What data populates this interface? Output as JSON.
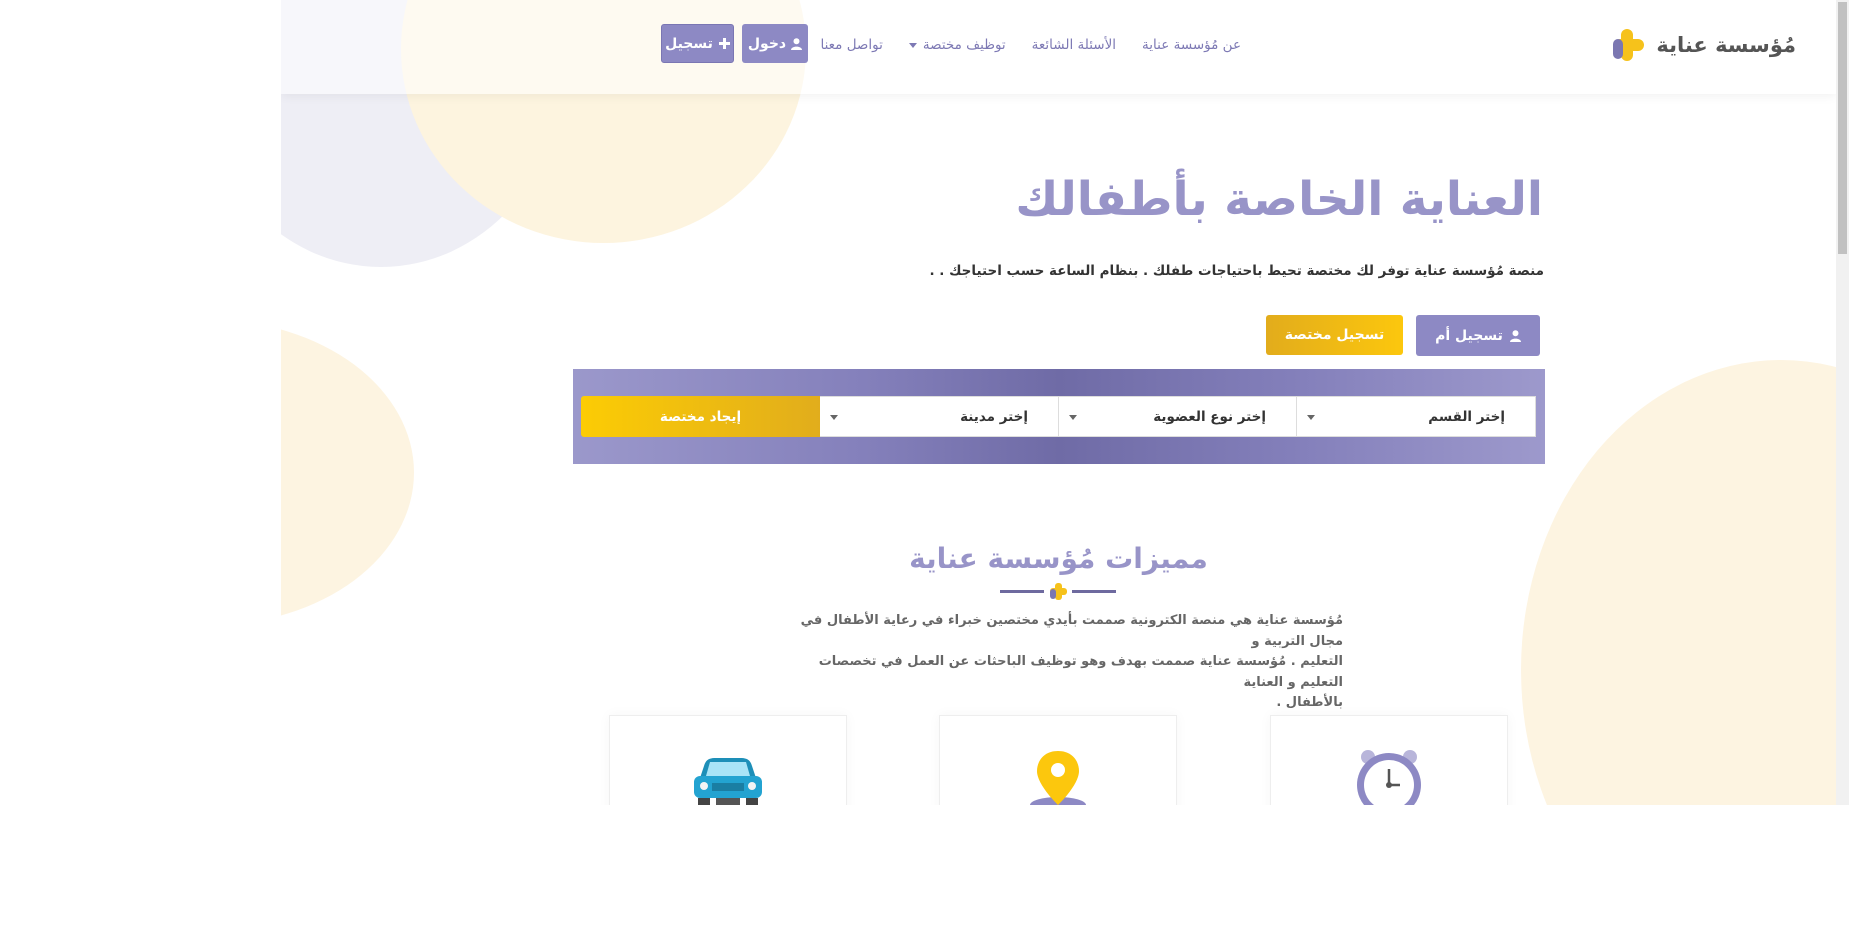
{
  "header": {
    "logo_text": "مُؤسسة عناية",
    "nav": {
      "about": "عن مُؤسسة عناية",
      "faq": "الأسئلة الشائعة",
      "hire": "توظيف مختصة",
      "contact": "تواصل معنا"
    },
    "login_label": "دخول",
    "register_label": "تسجيل"
  },
  "hero": {
    "title": "العناية الخاصة بأطفالك",
    "subtitle": "منصة مُؤسسة عناية توفر لك مختصة تحيط باحتياجات طفلك . بنظام الساعة حسب احتياجك . .",
    "register_mother": "تسجيل أم",
    "register_specialist": "تسجيل مختصة"
  },
  "search": {
    "category": "إختر القسم",
    "membership": "إختر نوع العضوية",
    "city": "إختر مدينة",
    "find_button": "إيجاد مختصة"
  },
  "features": {
    "title": "مميزات مُؤسسة عناية",
    "desc_line1": "مُؤسسة عناية هي منصة الكترونية صممت بأيدي مختصين خبراء في رعاية الأطفال في مجال التربية و",
    "desc_line2": "التعليم . مُؤسسة عناية صممت بهدف وهو توظيف الباحثات عن العمل في تخصصات التعليم و العناية",
    "desc_line3": "بالأطفال ."
  },
  "colors": {
    "primary": "#8d89c4",
    "accent": "#fcc70d",
    "title": "#9894c8"
  },
  "icons": [
    "user-icon",
    "plus-icon",
    "clock-icon",
    "location-pin-icon",
    "car-icon",
    "logo-icon"
  ]
}
